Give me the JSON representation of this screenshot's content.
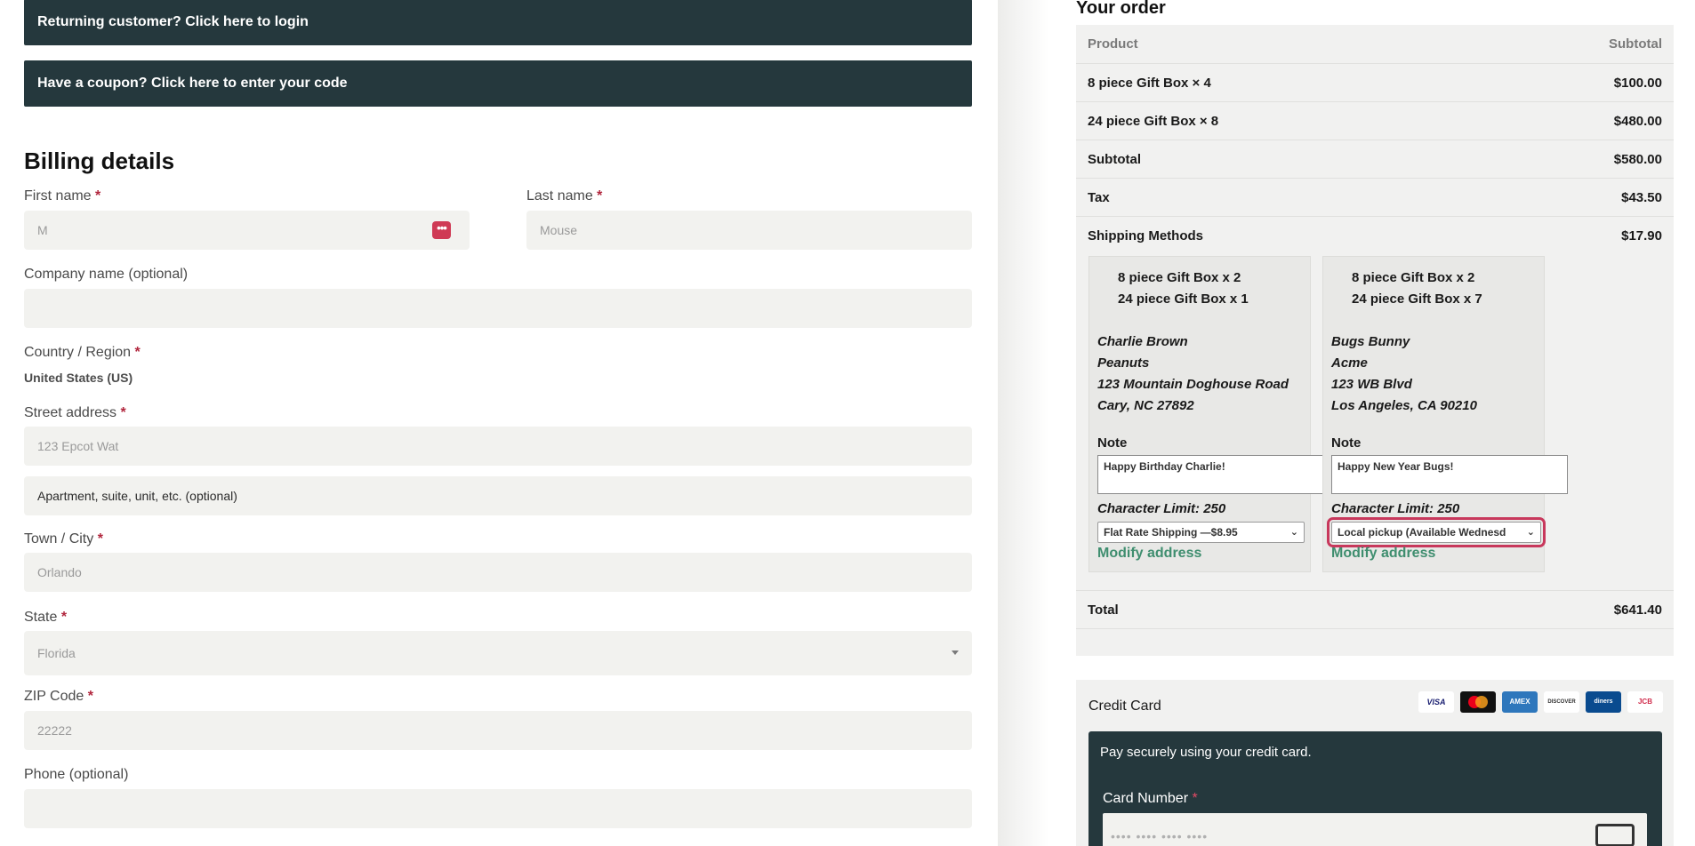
{
  "notices": {
    "login": "Returning customer? Click here to login",
    "coupon": "Have a coupon? Click here to enter your code"
  },
  "billing": {
    "title": "Billing details",
    "required_mark": "*",
    "first_name": {
      "label": "First name",
      "value": "M"
    },
    "last_name": {
      "label": "Last name",
      "value": "Mouse"
    },
    "company": {
      "label": "Company name (optional)",
      "value": ""
    },
    "country": {
      "label": "Country / Region",
      "value": "United States (US)"
    },
    "street": {
      "label": "Street address",
      "value": "123 Epcot Wat",
      "placeholder2": "Apartment, suite, unit, etc. (optional)"
    },
    "city": {
      "label": "Town / City",
      "value": "Orlando"
    },
    "state": {
      "label": "State",
      "value": "Florida"
    },
    "zip": {
      "label": "ZIP Code",
      "value": "22222"
    },
    "phone": {
      "label": "Phone (optional)",
      "value": ""
    },
    "password_icon": "password-manager-icon"
  },
  "order": {
    "title": "Your order",
    "columns": {
      "product": "Product",
      "subtotal": "Subtotal"
    },
    "items": [
      {
        "name": "8 piece Gift Box  × 4",
        "price": "$100.00"
      },
      {
        "name": "24 piece Gift Box  × 8",
        "price": "$480.00"
      }
    ],
    "subtotal": {
      "label": "Subtotal",
      "value": "$580.00"
    },
    "tax": {
      "label": "Tax",
      "value": "$43.50"
    },
    "shipping": {
      "label": "Shipping Methods",
      "value": "$17.90"
    },
    "packages": [
      {
        "items": [
          "8 piece Gift Box x 2",
          "24 piece Gift Box x 1"
        ],
        "address": [
          "Charlie Brown",
          "Peanuts",
          "123 Mountain Doghouse Road",
          "Cary, NC 27892"
        ],
        "note_label": "Note",
        "note": "Happy Birthday Charlie!",
        "limit": "Character Limit: 250",
        "shipping_option": "Flat Rate Shipping —$8.95",
        "modify": "Modify address"
      },
      {
        "items": [
          "8 piece Gift Box x 2",
          "24 piece Gift Box x 7"
        ],
        "address": [
          "Bugs Bunny",
          "Acme",
          "123 WB Blvd",
          "Los Angeles, CA 90210"
        ],
        "note_label": "Note",
        "note": "Happy New Year Bugs!",
        "limit": "Character Limit: 250",
        "shipping_option": "Local pickup (Available Wednesd",
        "modify": "Modify address"
      }
    ],
    "total": {
      "label": "Total",
      "value": "$641.40"
    }
  },
  "payment": {
    "title": "Credit Card",
    "secure_text": "Pay securely using your credit card.",
    "card_number_label": "Card Number",
    "card_placeholder": "•••• •••• •••• ••••",
    "logos": [
      "VISA",
      "mastercard",
      "AMEX",
      "DISCOVER",
      "diners",
      "JCB"
    ]
  },
  "colors": {
    "notice_bg": "#25383d",
    "required": "#b1263d",
    "link_green": "#3f8e6f",
    "highlight": "#c8385c"
  }
}
